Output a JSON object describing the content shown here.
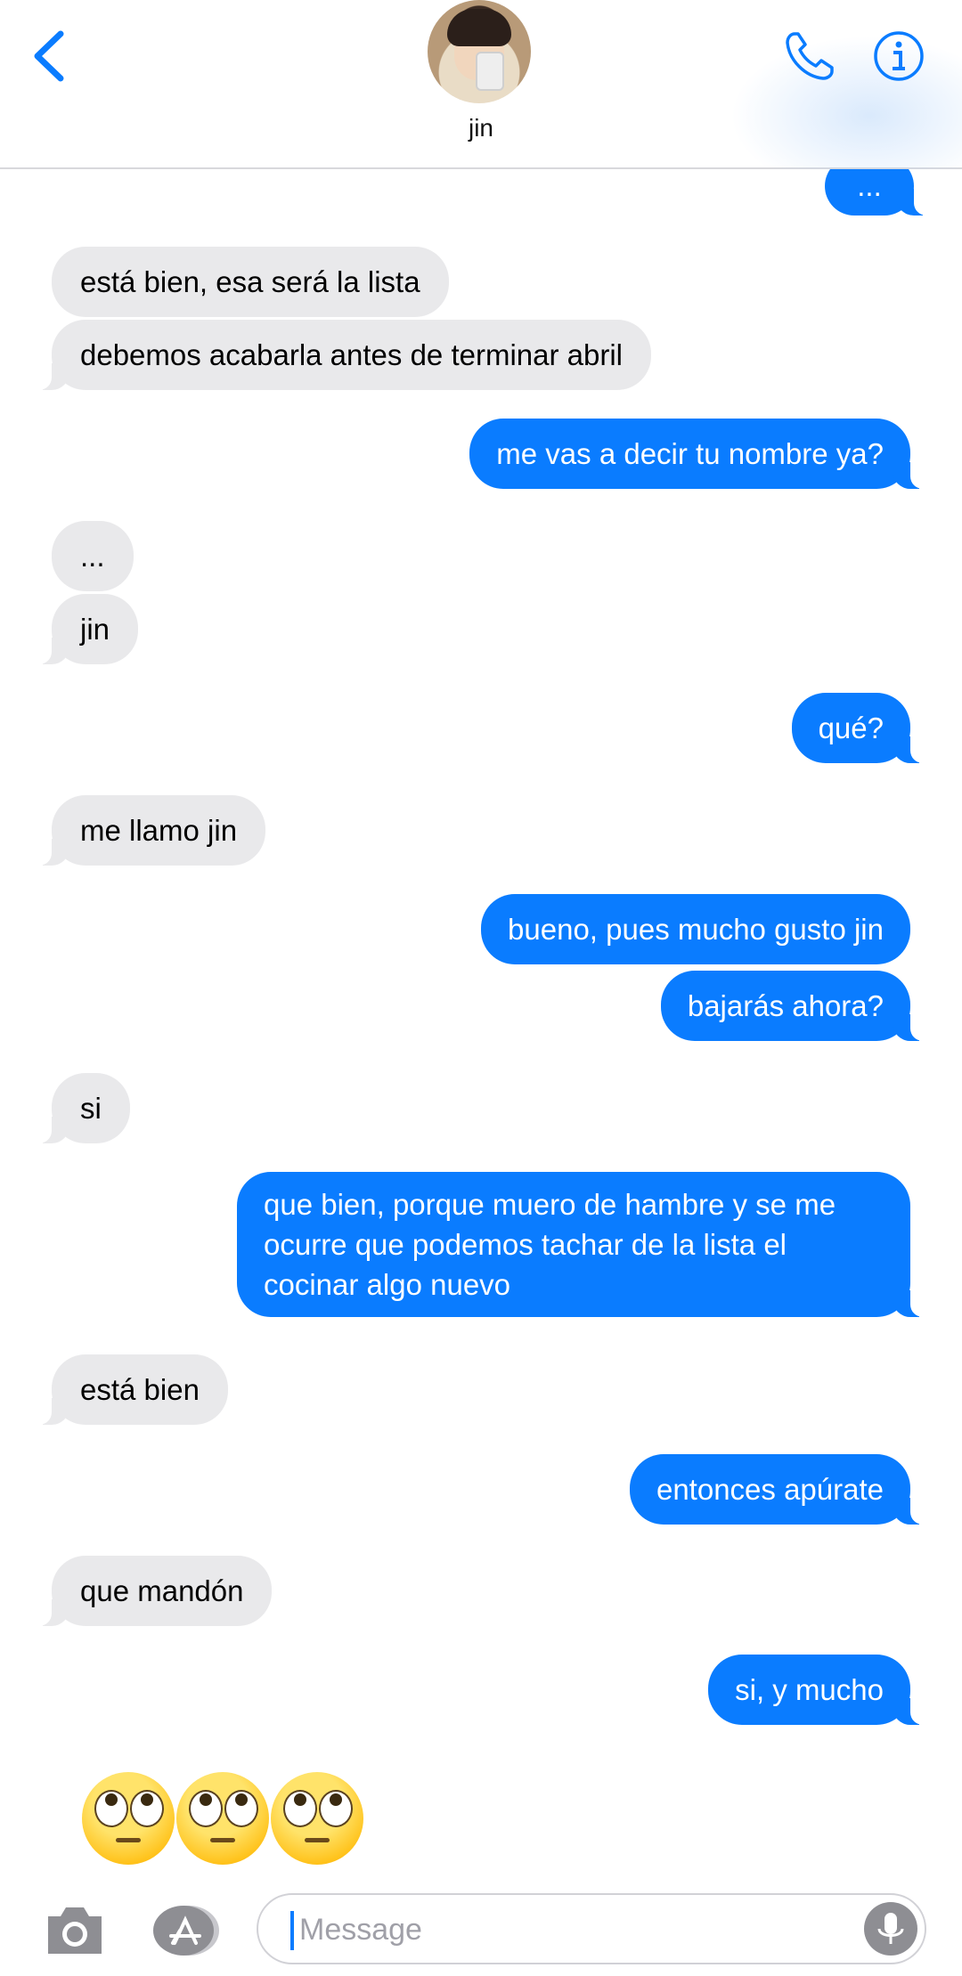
{
  "header": {
    "contact_name": "jin"
  },
  "messages": [
    {
      "side": "out",
      "text": "..."
    },
    {
      "side": "in",
      "text": "está bien, esa será la lista"
    },
    {
      "side": "in",
      "text": "debemos acabarla antes de terminar abril"
    },
    {
      "side": "out",
      "text": "me vas a decir tu nombre ya?"
    },
    {
      "side": "in",
      "text": "..."
    },
    {
      "side": "in",
      "text": "jin"
    },
    {
      "side": "out",
      "text": "qué?"
    },
    {
      "side": "in",
      "text": "me llamo jin"
    },
    {
      "side": "out",
      "text": "bueno, pues mucho gusto jin"
    },
    {
      "side": "out",
      "text": "bajarás ahora?"
    },
    {
      "side": "in",
      "text": "si"
    },
    {
      "side": "out",
      "text": "que bien, porque muero de hambre y se me ocurre que podemos tachar de la lista el cocinar algo nuevo"
    },
    {
      "side": "in",
      "text": "está bien"
    },
    {
      "side": "out",
      "text": "entonces apúrate"
    },
    {
      "side": "in",
      "text": "que mandón"
    },
    {
      "side": "out",
      "text": "si, y mucho"
    }
  ],
  "emoji_message": {
    "emoji": "face-with-rolling-eyes",
    "count": 3
  },
  "input_bar": {
    "placeholder": "Message"
  },
  "colors": {
    "outgoing_bubble": "#0a7cff",
    "incoming_bubble": "#e9e9eb",
    "accent": "#0a7cff"
  },
  "icons": [
    "back-chevron-icon",
    "phone-icon",
    "info-icon",
    "camera-icon",
    "app-store-icon",
    "microphone-icon"
  ]
}
